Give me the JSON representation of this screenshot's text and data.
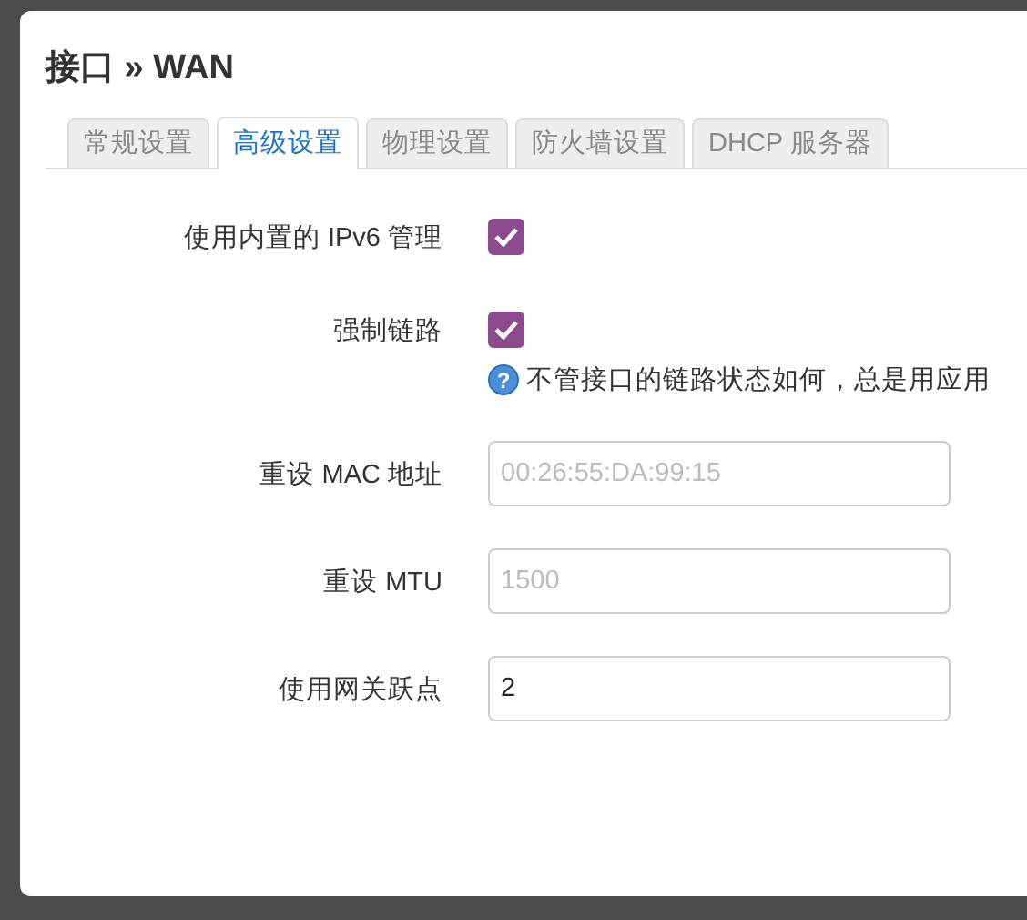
{
  "dialog": {
    "title": "接口 » WAN",
    "tabs": [
      {
        "label": "常规设置",
        "selected": false
      },
      {
        "label": "高级设置",
        "selected": true
      },
      {
        "label": "物理设置",
        "selected": false
      },
      {
        "label": "防火墙设置",
        "selected": false
      },
      {
        "label": "DHCP 服务器",
        "selected": false
      }
    ],
    "fields": [
      {
        "kind": "checkbox",
        "label": "使用内置的 IPv6 管理",
        "checked": true
      },
      {
        "kind": "checkbox",
        "label": "强制链路",
        "checked": true,
        "help_icon": "?",
        "help": "不管接口的链路状态如何，总是用应用"
      },
      {
        "kind": "text",
        "label": "重设 MAC 地址",
        "placeholder": "00:26:55:DA:99:15"
      },
      {
        "kind": "text",
        "label": "重设 MTU",
        "placeholder": "1500"
      },
      {
        "kind": "text",
        "label": "使用网关跃点",
        "value": "2"
      }
    ]
  }
}
